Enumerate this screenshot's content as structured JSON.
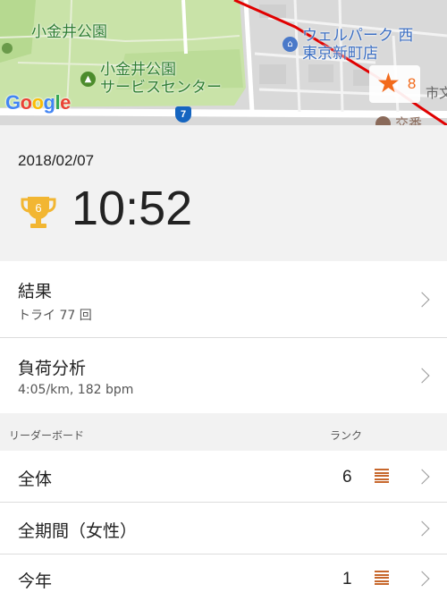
{
  "map": {
    "labels": {
      "park": "小金井公園",
      "service_center_line1": "小金井公園",
      "service_center_line2": "サービスセンター",
      "shop_line1": "ウェルパーク 西",
      "shop_line2": "東京新町店",
      "partial_right": "市文",
      "partial_bottom": "交番"
    },
    "google": [
      "G",
      "o",
      "o",
      "g",
      "l",
      "e"
    ],
    "google_colors": [
      "#4285F4",
      "#EA4335",
      "#FBBC05",
      "#4285F4",
      "#34A853",
      "#EA4335"
    ],
    "route_number": "7",
    "segment_count": "8",
    "route_color": "#e00000",
    "accent_color": "#f26a1b"
  },
  "header": {
    "date": "2018/02/07",
    "trophy_rank": "6",
    "time": "10:52"
  },
  "results": {
    "title": "結果",
    "subtitle": "トライ 77 回"
  },
  "load": {
    "title": "負荷分析",
    "subtitle": "4:05/km, 182 bpm"
  },
  "leaderboard": {
    "header_left": "リーダーボード",
    "header_right": "ランク",
    "rows": [
      {
        "label": "全体",
        "rank": "6"
      },
      {
        "label": "全期間（女性）",
        "rank": ""
      },
      {
        "label": "今年",
        "rank": "1"
      }
    ]
  }
}
